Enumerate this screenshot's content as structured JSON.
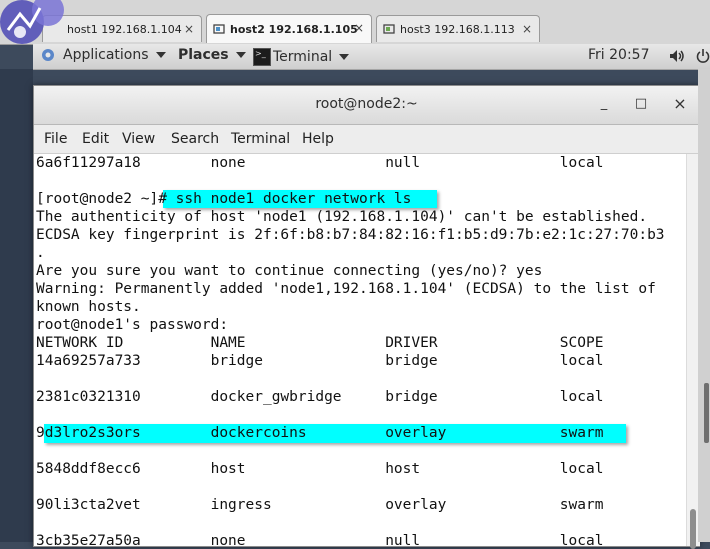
{
  "vm_tabs": [
    {
      "label": "host1 192.168.1.104",
      "active": false
    },
    {
      "label": "host2 192.168.1.105",
      "active": true
    },
    {
      "label": "host3 192.168.1.113",
      "active": false
    }
  ],
  "tab_close_glyph": "×",
  "gnome_bar": {
    "applications": "Applications",
    "places": "Places",
    "terminal": "Terminal",
    "clock": "Fri 20:57"
  },
  "window": {
    "title": "root@node2:~",
    "minimize": "_",
    "maximize": "□",
    "close": "×"
  },
  "menu": [
    "File",
    "Edit",
    "View",
    "Search",
    "Terminal",
    "Help"
  ],
  "terminal_lines": [
    "6a6f11297a18        none                null                local",
    "",
    "[root@node2 ~]# ssh node1 docker network ls",
    "The authenticity of host 'node1 (192.168.1.104)' can't be established.",
    "ECDSA key fingerprint is 2f:6f:b8:b7:84:82:16:f1:b5:d9:7b:e2:1c:27:70:b3",
    ".",
    "Are you sure you want to continue connecting (yes/no)? yes",
    "Warning: Permanently added 'node1,192.168.1.104' (ECDSA) to the list of",
    "known hosts.",
    "root@node1's password:",
    "NETWORK ID          NAME                DRIVER              SCOPE",
    "14a69257a733        bridge              bridge              local",
    "",
    "2381c0321310        docker_gwbridge     bridge              local",
    "",
    "9d3lro2s3ors        dockercoins         overlay             swarm",
    "",
    "5848ddf8ecc6        host                host                local",
    "",
    "90li3cta2vet        ingress             overlay             swarm",
    "",
    "3cb35e27a50a        none                null                local"
  ],
  "colors": {
    "highlight": "#00ffff",
    "terminal_bg": "#ffffff",
    "terminal_fg": "#111111"
  },
  "icons": [
    "vmware-logo-icon",
    "vm-tab-icon",
    "terminal-app-icon",
    "volume-icon",
    "power-icon"
  ]
}
